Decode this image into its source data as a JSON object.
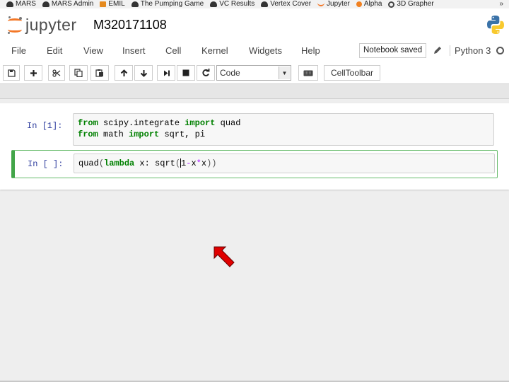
{
  "bookmarks": {
    "items": [
      {
        "label": "MARS",
        "icon": "cloud-icon"
      },
      {
        "label": "MARS Admin",
        "icon": "cloud-icon"
      },
      {
        "label": "EMIL",
        "icon": "m-icon"
      },
      {
        "label": "The Pumping Game",
        "icon": "cloud-icon"
      },
      {
        "label": "VC Results",
        "icon": "cloud-icon"
      },
      {
        "label": "Vertex Cover",
        "icon": "cloud-icon"
      },
      {
        "label": "Jupyter",
        "icon": "jupyter-icon"
      },
      {
        "label": "Alpha",
        "icon": "gear-icon"
      },
      {
        "label": "3D Grapher",
        "icon": "globe-icon"
      }
    ],
    "more_label": "»"
  },
  "header": {
    "logo_text": "jupyter",
    "notebook_name": "M320171108"
  },
  "menubar": {
    "items": [
      "File",
      "Edit",
      "View",
      "Insert",
      "Cell",
      "Kernel",
      "Widgets",
      "Help"
    ],
    "save_status": "Notebook saved",
    "kernel_name": "Python 3"
  },
  "toolbar": {
    "buttons": [
      "save-icon",
      "plus-icon",
      "cut-icon",
      "copy-icon",
      "paste-icon",
      "arrow-up-icon",
      "arrow-down-icon",
      "skip-forward-icon",
      "stop-icon",
      "restart-icon"
    ],
    "cell_type": "Code",
    "keyboard_icon": "keyboard-icon",
    "celltoolbar_label": "CellToolbar"
  },
  "cells": [
    {
      "prompt": "In [1]:",
      "lines": [
        [
          {
            "t": "from",
            "c": "kw"
          },
          {
            "t": " scipy.integrate ",
            "c": ""
          },
          {
            "t": "import",
            "c": "kw"
          },
          {
            "t": " quad",
            "c": ""
          }
        ],
        [
          {
            "t": "from",
            "c": "kw"
          },
          {
            "t": " math ",
            "c": ""
          },
          {
            "t": "import",
            "c": "kw"
          },
          {
            "t": " sqrt, pi",
            "c": ""
          }
        ]
      ]
    },
    {
      "prompt": "In [ ]:",
      "lines": [
        [
          {
            "t": "quad",
            "c": ""
          },
          {
            "t": "(",
            "c": "punc"
          },
          {
            "t": "lambda",
            "c": "kw"
          },
          {
            "t": " x: sqrt",
            "c": ""
          },
          {
            "t": "(",
            "c": "punc"
          },
          {
            "t": "1",
            "c": "cur"
          },
          {
            "t": "-",
            "c": "op"
          },
          {
            "t": "x",
            "c": ""
          },
          {
            "t": "*",
            "c": "op"
          },
          {
            "t": "x",
            "c": ""
          },
          {
            "t": "))",
            "c": "punc"
          }
        ]
      ]
    }
  ],
  "colors": {
    "jupyter_orange": "#f37726",
    "prompt_blue": "#303f9f",
    "selected_cell_green": "#42a548",
    "arrow_red": "#e00000"
  }
}
